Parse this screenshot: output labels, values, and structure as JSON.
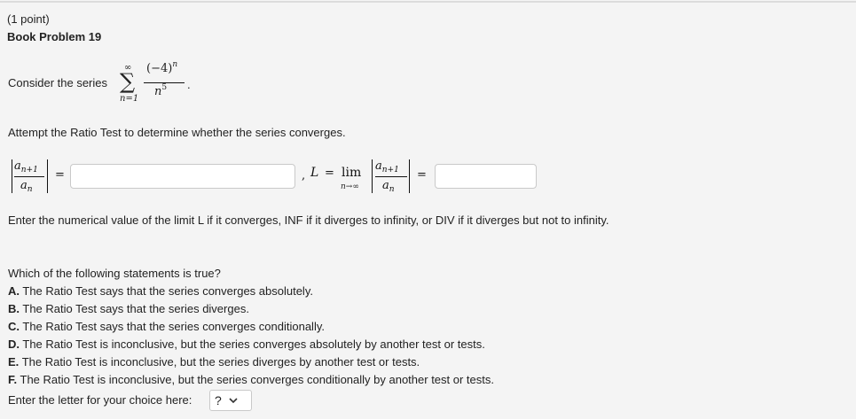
{
  "problem": {
    "points": "(1 point)",
    "title": "Book Problem 19",
    "consider_text": "Consider the series",
    "series": {
      "upper_limit": "∞",
      "lower_limit": "n=1",
      "numerator_base": "(−4)",
      "numerator_exp": "n",
      "denominator_base": "n",
      "denominator_exp": "5"
    },
    "instruction": "Attempt the Ratio Test to determine whether the series converges.",
    "ratio": {
      "num_var": "a",
      "num_sub": "n+1",
      "den_var": "a",
      "den_sub": "n",
      "equals": "=",
      "input1_value": "",
      "comma_text": ",",
      "L_label": "L",
      "lim_text": "lim",
      "lim_sub": "n→∞",
      "input2_value": ""
    },
    "limit_note": "Enter the numerical value of the limit L if it converges, INF if it diverges to infinity, or DIV if it diverges but not to infinity.",
    "question": "Which of the following statements is true?",
    "choices": [
      {
        "letter": "A.",
        "text": "The Ratio Test says that the series converges absolutely."
      },
      {
        "letter": "B.",
        "text": "The Ratio Test says that the series diverges."
      },
      {
        "letter": "C.",
        "text": "The Ratio Test says that the series converges conditionally."
      },
      {
        "letter": "D.",
        "text": "The Ratio Test is inconclusive, but the series converges absolutely by another test or tests."
      },
      {
        "letter": "E.",
        "text": "The Ratio Test is inconclusive, but the series diverges by another test or tests."
      },
      {
        "letter": "F.",
        "text": "The Ratio Test is inconclusive, but the series converges conditionally by another test or tests."
      }
    ],
    "choice_prompt": "Enter the letter for your choice here:",
    "choice_select_value": "?",
    "icons": {
      "select": "chevron-down-icon"
    }
  }
}
